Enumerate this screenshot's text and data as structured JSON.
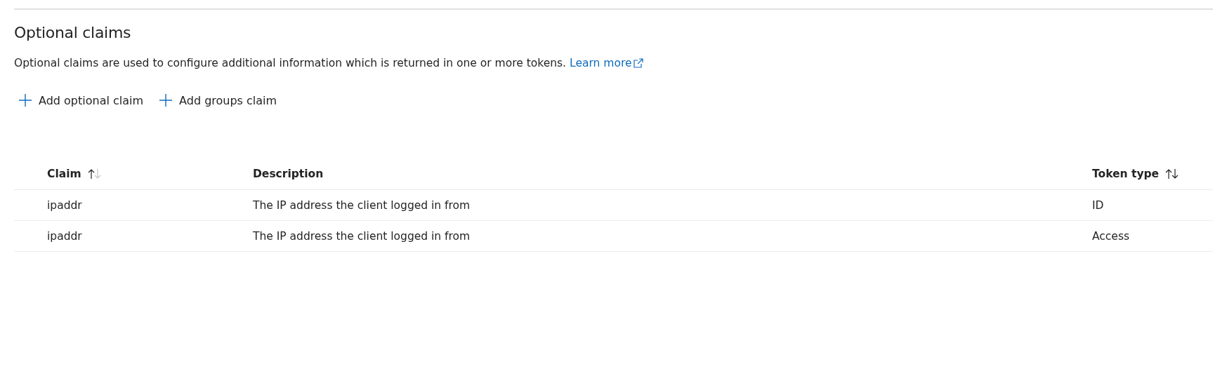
{
  "section": {
    "title": "Optional claims",
    "description": "Optional claims are used to configure additional information which is returned in one or more tokens.",
    "link": "Learn more"
  },
  "toolbar": [
    {
      "label": "Add optional claim"
    },
    {
      "label": "Add groups claim"
    }
  ],
  "table": {
    "columns": [
      {
        "label": "Claim",
        "sortable": true,
        "sorted_ascending": true
      },
      {
        "label": "Description",
        "sortable": false
      },
      {
        "label": "Token type",
        "sortable": true,
        "sorted_ascending": false
      }
    ],
    "rows": [
      [
        "ipaddr",
        "The IP address the client logged in from",
        "ID"
      ],
      [
        "ipaddr",
        "The IP address the client logged in from",
        "Access"
      ]
    ]
  }
}
